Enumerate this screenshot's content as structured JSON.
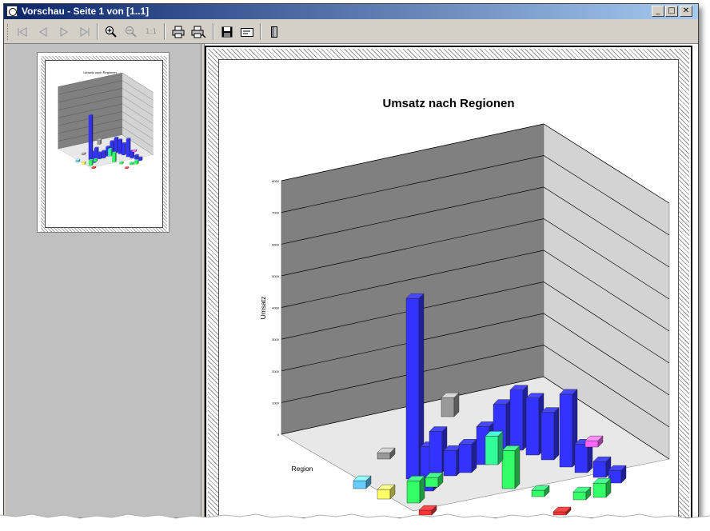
{
  "window": {
    "title": "Vorschau - Seite 1 von [1..1]",
    "buttons": {
      "minimize": "_",
      "maximize": "□",
      "close": "✕"
    }
  },
  "toolbar": {
    "buttons": [
      {
        "name": "first-page-button",
        "icon": "first-page-icon",
        "enabled": false
      },
      {
        "name": "previous-page-button",
        "icon": "previous-page-icon",
        "enabled": false
      },
      {
        "name": "next-page-button",
        "icon": "next-page-icon",
        "enabled": false
      },
      {
        "name": "last-page-button",
        "icon": "last-page-icon",
        "enabled": false
      },
      {
        "name": "zoom-in-button",
        "icon": "zoom-in-icon",
        "enabled": true
      },
      {
        "name": "zoom-out-button",
        "icon": "zoom-out-icon",
        "enabled": false
      },
      {
        "name": "zoom-1to1-button",
        "icon": "one-to-one-icon",
        "label": "1:1",
        "enabled": false
      },
      {
        "name": "print-button",
        "icon": "printer-icon",
        "enabled": true
      },
      {
        "name": "print-setup-button",
        "icon": "printer-setup-icon",
        "enabled": true
      },
      {
        "name": "save-button",
        "icon": "floppy-disk-icon",
        "enabled": true
      },
      {
        "name": "send-button",
        "icon": "envelope-icon",
        "enabled": true
      },
      {
        "name": "exit-button",
        "icon": "door-exit-icon",
        "enabled": true
      }
    ]
  },
  "colors": {
    "titlebar_start": "#0a246a",
    "titlebar_end": "#a6caf0",
    "window_face": "#d4d0c8",
    "thumbnail_pane": "#c0c0c0",
    "back_wall": "#808080",
    "side_wall": "#d3d3d3",
    "floor": "#e8e8e8"
  },
  "chart_data": {
    "type": "bar",
    "subtype": "3d-bar",
    "title": "Umsatz nach Regionen",
    "ylabel": "Umsatz",
    "xlabel": "Region",
    "ylim": [
      0,
      8000
    ],
    "grid": true,
    "yticks": [
      "0",
      "1000",
      "2000",
      "3000",
      "4000",
      "5000",
      "6000",
      "7000",
      "8000"
    ],
    "bars": [
      {
        "color": "#3333ff",
        "value": 5700
      },
      {
        "color": "#3333ff",
        "value": 1400
      },
      {
        "color": "#3333ff",
        "value": 1300
      },
      {
        "color": "#3333ff",
        "value": 800
      },
      {
        "color": "#3333ff",
        "value": 900
      },
      {
        "color": "#3333ff",
        "value": 1200
      },
      {
        "color": "#3333ff",
        "value": 1500
      },
      {
        "color": "#3333ff",
        "value": 1900
      },
      {
        "color": "#3333ff",
        "value": 1800
      },
      {
        "color": "#3333ff",
        "value": 1500
      },
      {
        "color": "#3333ff",
        "value": 2300
      },
      {
        "color": "#3333ff",
        "value": 900
      },
      {
        "color": "#3333ff",
        "value": 500
      },
      {
        "color": "#3333ff",
        "value": 400
      },
      {
        "color": "#33ff66",
        "value": 700
      },
      {
        "color": "#33ff66",
        "value": 300
      },
      {
        "color": "#33ff66",
        "value": 1200
      },
      {
        "color": "#33ff66",
        "value": 200
      },
      {
        "color": "#33ff66",
        "value": 250
      },
      {
        "color": "#33ff66",
        "value": 450
      },
      {
        "color": "#33ff99",
        "value": 900
      },
      {
        "color": "#999999",
        "value": 600
      },
      {
        "color": "#999999",
        "value": 200
      },
      {
        "color": "#ff3333",
        "value": 150
      },
      {
        "color": "#ff3333",
        "value": 100
      },
      {
        "color": "#ffff66",
        "value": 300
      },
      {
        "color": "#ff66ff",
        "value": 200
      },
      {
        "color": "#66ccff",
        "value": 250
      }
    ]
  }
}
